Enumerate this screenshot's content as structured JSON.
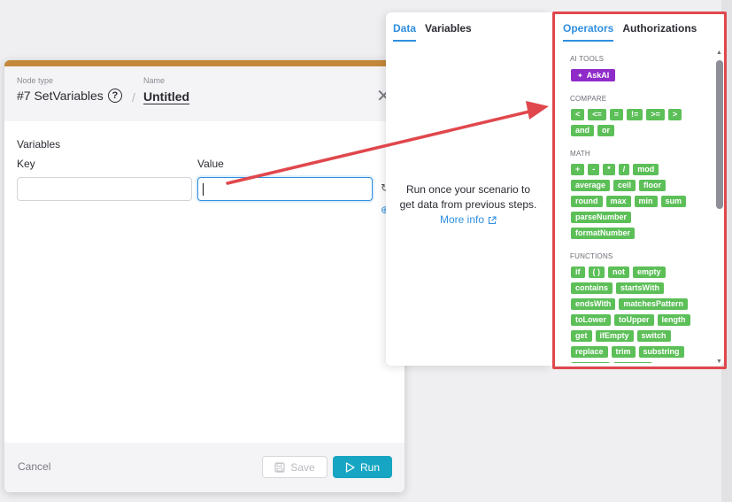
{
  "node": {
    "type_label": "Node type",
    "type": "#7 SetVariables",
    "help_glyph": "?",
    "separator": "/",
    "name_label": "Name",
    "name": "Untitled",
    "close_glyph": "✕"
  },
  "variables": {
    "title": "Variables",
    "key_label": "Key",
    "value_label": "Value",
    "key_value": "",
    "value_value": ""
  },
  "footer": {
    "cancel_label": "Cancel",
    "save_label": "Save",
    "run_label": "Run"
  },
  "data_panel": {
    "tabs": [
      "Data",
      "Variables"
    ],
    "active_tab": "Data",
    "empty_line1": "Run once your scenario to",
    "empty_line2": "get data from previous steps.",
    "more_info": "More info"
  },
  "operators_panel": {
    "tabs": [
      "Operators",
      "Authorizations"
    ],
    "active_tab": "Operators",
    "sections": [
      {
        "label": "AI TOOLS",
        "rows": [
          [
            "AskAI"
          ]
        ]
      },
      {
        "label": "COMPARE",
        "rows": [
          [
            "<",
            "<=",
            "=",
            "!=",
            ">=",
            ">"
          ],
          [
            "and",
            "or"
          ]
        ]
      },
      {
        "label": "MATH",
        "rows": [
          [
            "+",
            "-",
            "*",
            "/",
            "mod"
          ],
          [
            "average",
            "ceil",
            "floor"
          ],
          [
            "round",
            "max",
            "min",
            "sum"
          ],
          [
            "parseNumber"
          ],
          [
            "formatNumber"
          ]
        ]
      },
      {
        "label": "FUNCTIONS",
        "rows": [
          [
            "if",
            "( )",
            "not",
            "empty"
          ],
          [
            "contains",
            "startsWith"
          ],
          [
            "endsWith",
            "matchesPattern"
          ],
          [
            "toLower",
            "toUpper",
            "length"
          ],
          [
            "get",
            "ifEmpty",
            "switch"
          ],
          [
            "replace",
            "trim",
            "substring"
          ],
          [
            "indexOf",
            "toString"
          ]
        ]
      }
    ]
  },
  "colors": {
    "accent_blue": "#2f8fe0",
    "run_teal": "#16a5c2",
    "chip_green": "#5cbf58",
    "ai_purple": "#8f2bc8",
    "annotation_red": "#e0474c",
    "node_accent": "#c3883a"
  },
  "icons": {
    "help": "help-circle-icon",
    "close": "close-icon",
    "save": "floppy-disk-icon",
    "run": "play-icon",
    "external": "external-link-icon",
    "ai": "sparkle-icon"
  }
}
